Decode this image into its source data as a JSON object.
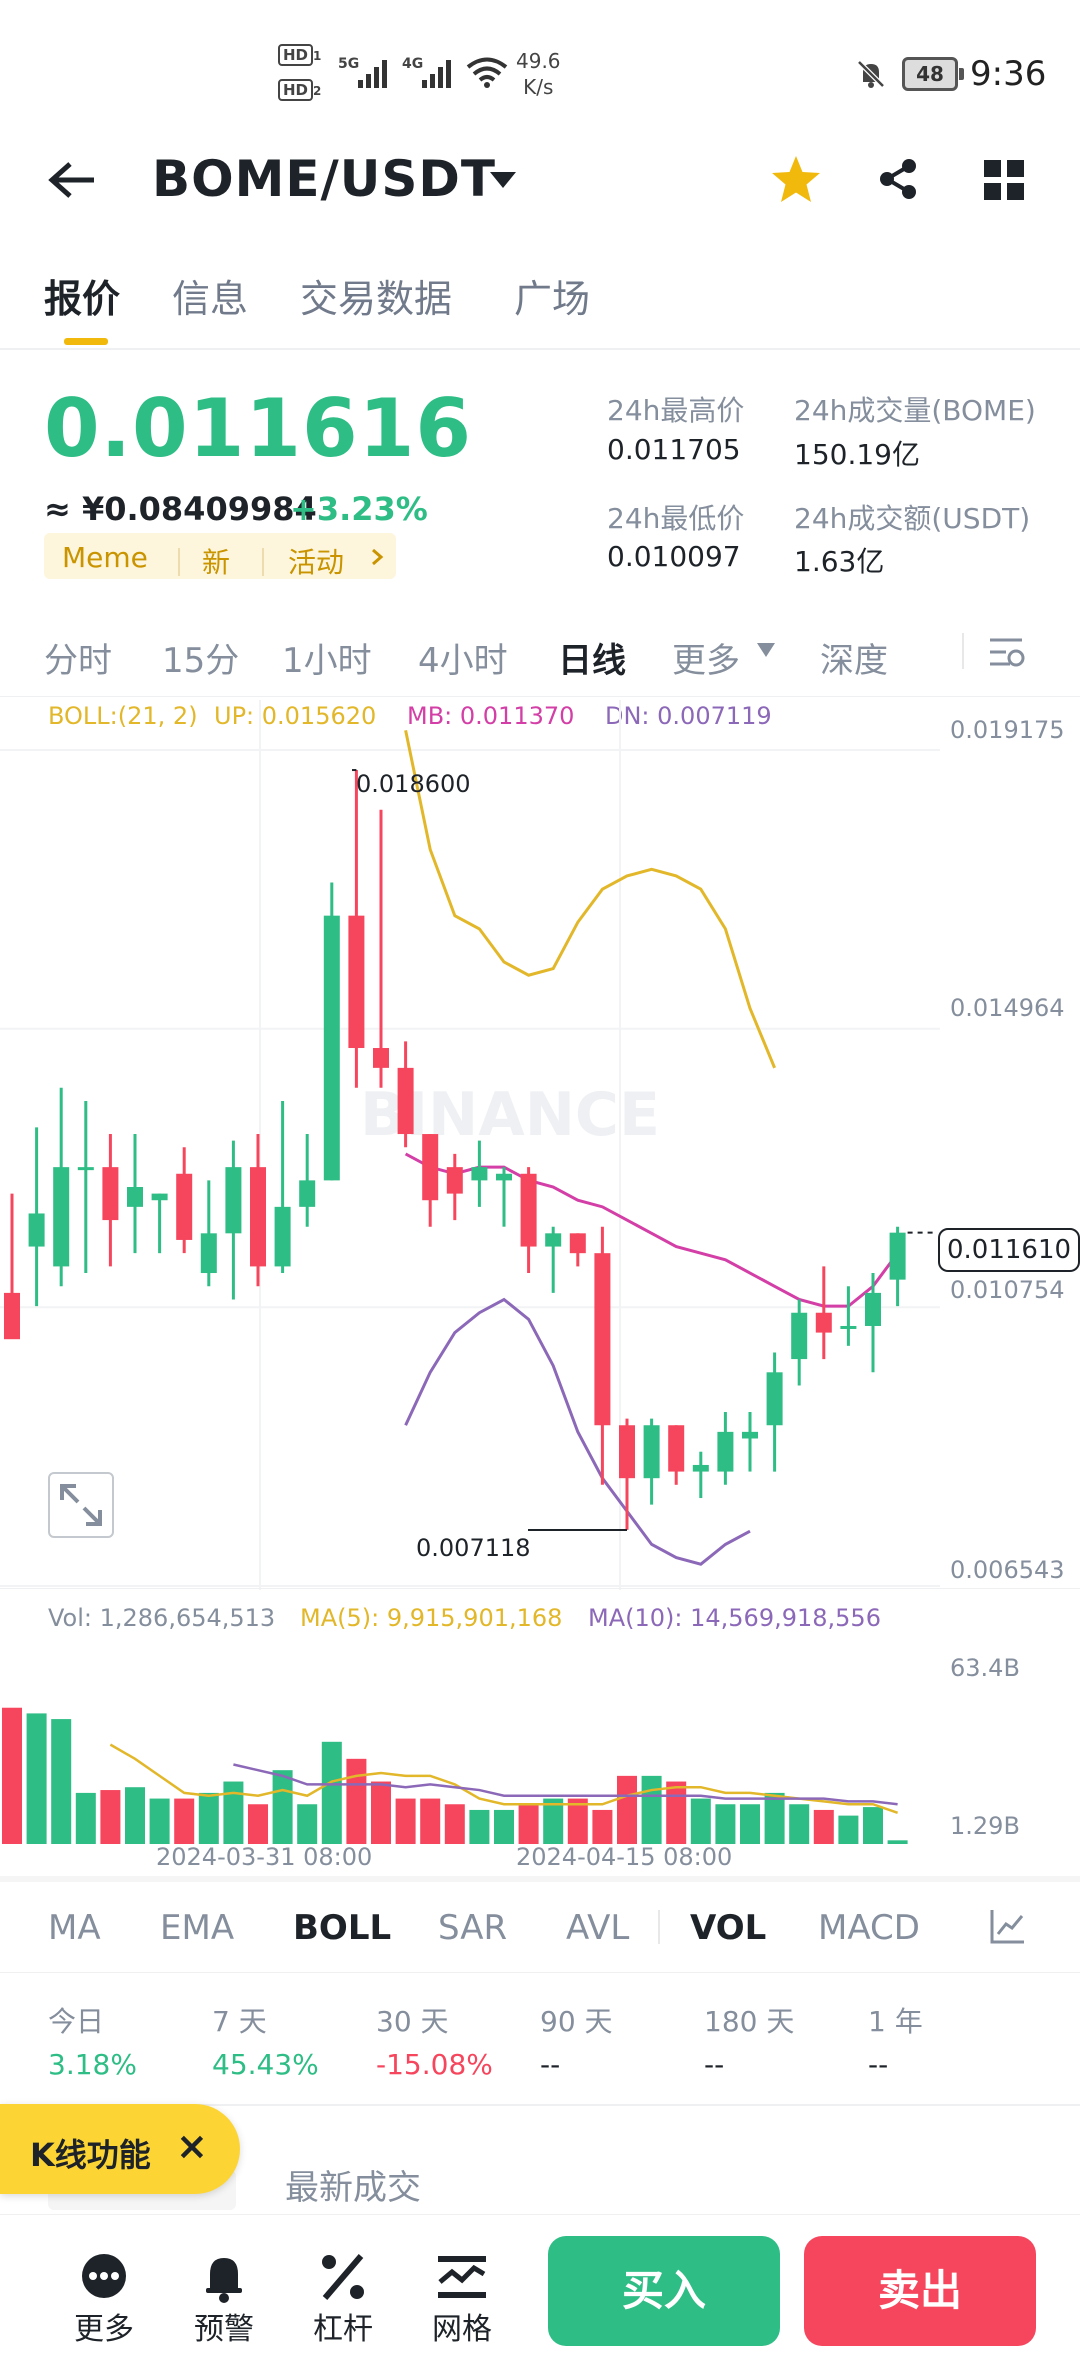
{
  "status_bar": {
    "hd1": "HD",
    "hd1_n": "1",
    "hd2": "HD",
    "hd2_n": "2",
    "sig1": "5G",
    "sig2": "4G",
    "net_speed": "49.6",
    "net_unit": "K/s",
    "battery": "48",
    "time": "9:36"
  },
  "header": {
    "pair": "BOME/USDT",
    "icons": [
      "back-arrow-icon",
      "dropdown-caret-icon",
      "star-icon",
      "share-icon",
      "grid-menu-icon"
    ],
    "star_color": "#f0b90b"
  },
  "tabs": [
    {
      "label": "报价",
      "active": true
    },
    {
      "label": "信息",
      "active": false
    },
    {
      "label": "交易数据",
      "active": false
    },
    {
      "label": "广场",
      "active": false
    }
  ],
  "price": {
    "last": "0.011616",
    "cny": "≈ ¥0.08409984",
    "change": "+3.23%",
    "tags": [
      "Meme",
      "新",
      "活动"
    ],
    "stats": [
      {
        "label": "24h最高价",
        "value": "0.011705"
      },
      {
        "label": "24h成交量(BOME)",
        "value": "150.19亿"
      },
      {
        "label": "24h最低价",
        "value": "0.010097"
      },
      {
        "label": "24h成交额(USDT)",
        "value": "1.63亿"
      }
    ]
  },
  "intervals": [
    {
      "label": "分时",
      "active": false
    },
    {
      "label": "15分",
      "active": false
    },
    {
      "label": "1小时",
      "active": false
    },
    {
      "label": "4小时",
      "active": false
    },
    {
      "label": "日线",
      "active": true
    },
    {
      "label": "更多",
      "active": false
    },
    {
      "label": "深度",
      "active": false
    }
  ],
  "chart_data": {
    "type": "candlestick",
    "indicator": {
      "boll": "BOLL:(21, 2)",
      "up": "UP: 0.015620",
      "mb": "MB: 0.011370",
      "dn": "DN: 0.007119"
    },
    "price_axis": [
      "0.019175",
      "0.014964",
      "0.010754",
      "0.006543"
    ],
    "current_price": "0.011610",
    "high_marker": "0.018600",
    "low_marker": "0.007118",
    "watermark": "BINANCE",
    "colors": {
      "up": "#2ebd85",
      "down": "#f6465d",
      "boll_up": "#e2b72a",
      "boll_mb": "#d33fa6",
      "boll_dn": "#8c68b8"
    },
    "candles": [
      {
        "o": 0.0107,
        "h": 0.0122,
        "l": 0.0102,
        "c": 0.01
      },
      {
        "o": 0.0114,
        "h": 0.0132,
        "l": 0.0105,
        "c": 0.0119
      },
      {
        "o": 0.0111,
        "h": 0.0138,
        "l": 0.0108,
        "c": 0.0126
      },
      {
        "o": 0.0126,
        "h": 0.0136,
        "l": 0.011,
        "c": 0.0126
      },
      {
        "o": 0.0126,
        "h": 0.0131,
        "l": 0.0111,
        "c": 0.0118
      },
      {
        "o": 0.012,
        "h": 0.0131,
        "l": 0.0113,
        "c": 0.0123
      },
      {
        "o": 0.0121,
        "h": 0.0122,
        "l": 0.0113,
        "c": 0.0122
      },
      {
        "o": 0.0125,
        "h": 0.0129,
        "l": 0.0113,
        "c": 0.0115
      },
      {
        "o": 0.011,
        "h": 0.0124,
        "l": 0.0108,
        "c": 0.0116
      },
      {
        "o": 0.0116,
        "h": 0.013,
        "l": 0.0106,
        "c": 0.0126
      },
      {
        "o": 0.0126,
        "h": 0.0131,
        "l": 0.0108,
        "c": 0.0111
      },
      {
        "o": 0.0111,
        "h": 0.0136,
        "l": 0.011,
        "c": 0.012
      },
      {
        "o": 0.012,
        "h": 0.0131,
        "l": 0.0117,
        "c": 0.0124
      },
      {
        "o": 0.0124,
        "h": 0.0169,
        "l": 0.0124,
        "c": 0.0164
      },
      {
        "o": 0.0164,
        "h": 0.0186,
        "l": 0.0138,
        "c": 0.0144
      },
      {
        "o": 0.0144,
        "h": 0.018,
        "l": 0.0138,
        "c": 0.0141
      },
      {
        "o": 0.0141,
        "h": 0.0145,
        "l": 0.0129,
        "c": 0.0131
      },
      {
        "o": 0.0131,
        "h": 0.0131,
        "l": 0.0117,
        "c": 0.0121
      },
      {
        "o": 0.0126,
        "h": 0.0128,
        "l": 0.0118,
        "c": 0.0122
      },
      {
        "o": 0.0124,
        "h": 0.013,
        "l": 0.012,
        "c": 0.0126
      },
      {
        "o": 0.0124,
        "h": 0.0126,
        "l": 0.0117,
        "c": 0.0125
      },
      {
        "o": 0.0125,
        "h": 0.0126,
        "l": 0.011,
        "c": 0.0114
      },
      {
        "o": 0.0114,
        "h": 0.0117,
        "l": 0.0107,
        "c": 0.0116
      },
      {
        "o": 0.0116,
        "h": 0.0116,
        "l": 0.0111,
        "c": 0.0113
      },
      {
        "o": 0.0113,
        "h": 0.0117,
        "l": 0.0078,
        "c": 0.0087
      },
      {
        "o": 0.0087,
        "h": 0.0088,
        "l": 0.00712,
        "c": 0.0079
      },
      {
        "o": 0.0079,
        "h": 0.0088,
        "l": 0.0075,
        "c": 0.0087
      },
      {
        "o": 0.0087,
        "h": 0.0087,
        "l": 0.0078,
        "c": 0.008
      },
      {
        "o": 0.008,
        "h": 0.0083,
        "l": 0.0076,
        "c": 0.0081
      },
      {
        "o": 0.008,
        "h": 0.0089,
        "l": 0.0078,
        "c": 0.0086
      },
      {
        "o": 0.0085,
        "h": 0.0089,
        "l": 0.008,
        "c": 0.0086
      },
      {
        "o": 0.0087,
        "h": 0.0098,
        "l": 0.008,
        "c": 0.0095
      },
      {
        "o": 0.0097,
        "h": 0.0106,
        "l": 0.0093,
        "c": 0.0104
      },
      {
        "o": 0.0104,
        "h": 0.0111,
        "l": 0.0097,
        "c": 0.0101
      },
      {
        "o": 0.0102,
        "h": 0.0108,
        "l": 0.0099,
        "c": 0.0102
      },
      {
        "o": 0.0102,
        "h": 0.011,
        "l": 0.0095,
        "c": 0.0107
      },
      {
        "o": 0.0109,
        "h": 0.0117,
        "l": 0.0105,
        "c": 0.01161
      }
    ],
    "boll_up": [
      null,
      null,
      null,
      null,
      null,
      null,
      null,
      null,
      null,
      null,
      null,
      null,
      null,
      null,
      null,
      null,
      0.0192,
      0.0174,
      0.0164,
      0.0162,
      0.0157,
      0.0155,
      0.0156,
      0.0163,
      0.0168,
      0.017,
      0.0171,
      0.017,
      0.0168,
      0.0162,
      0.015,
      0.0141
    ],
    "boll_mb": [
      null,
      null,
      null,
      null,
      null,
      null,
      null,
      null,
      null,
      null,
      null,
      null,
      null,
      null,
      null,
      null,
      0.0128,
      0.0126,
      0.0125,
      0.0126,
      0.0126,
      0.0124,
      0.0123,
      0.0121,
      0.012,
      0.0118,
      0.0116,
      0.0114,
      0.0113,
      0.0112,
      0.011,
      0.0108,
      0.0106,
      0.0105,
      0.0105,
      0.0108,
      0.0113
    ],
    "boll_dn": [
      null,
      null,
      null,
      null,
      null,
      null,
      null,
      null,
      null,
      null,
      null,
      null,
      null,
      null,
      null,
      null,
      0.0087,
      0.0095,
      0.0101,
      0.0104,
      0.0106,
      0.0103,
      0.0096,
      0.0086,
      0.0079,
      0.0074,
      0.0069,
      0.0067,
      0.0066,
      0.0069,
      0.0071
    ],
    "volume": {
      "label_vol": "Vol: 1,286,654,513",
      "label_ma5": "MA(5): 9,915,901,168",
      "label_ma10": "MA(10): 14,569,918,556",
      "axis": [
        "63.4B",
        "1.29B"
      ],
      "dates": [
        "2024-03-31 08:00",
        "2024-04-15 08:00"
      ],
      "bars": [
        48,
        46,
        44,
        18,
        19,
        20,
        16,
        16,
        18,
        22,
        14,
        26,
        14,
        36,
        30,
        22,
        16,
        16,
        14,
        12,
        12,
        14,
        16,
        16,
        12,
        24,
        24,
        22,
        16,
        14,
        14,
        18,
        14,
        12,
        10,
        13,
        1.3
      ],
      "ma5": [
        null,
        null,
        null,
        null,
        35,
        30,
        24,
        18,
        17,
        18,
        17,
        19,
        17,
        22,
        24,
        25,
        24,
        24,
        21,
        16,
        14,
        14,
        14,
        14,
        14,
        17,
        19,
        20,
        20,
        18,
        18,
        17,
        16,
        15,
        14,
        14,
        11
      ],
      "ma10": [
        null,
        null,
        null,
        null,
        null,
        null,
        null,
        null,
        null,
        28,
        26,
        24,
        21,
        21,
        21,
        21,
        20,
        21,
        20,
        19,
        17,
        17,
        17,
        17,
        17,
        17,
        17,
        17,
        17,
        16,
        16,
        16,
        16,
        16,
        15,
        15,
        14
      ]
    }
  },
  "indicators": [
    {
      "label": "MA",
      "active": false
    },
    {
      "label": "EMA",
      "active": false
    },
    {
      "label": "BOLL",
      "active": true
    },
    {
      "label": "SAR",
      "active": false
    },
    {
      "label": "AVL",
      "active": false
    },
    {
      "label": "VOL",
      "active": true
    },
    {
      "label": "MACD",
      "active": false
    }
  ],
  "performance": [
    {
      "label": "今日",
      "value": "3.18%",
      "color": "#2ebd85"
    },
    {
      "label": "7 天",
      "value": "45.43%",
      "color": "#2ebd85"
    },
    {
      "label": "30 天",
      "value": "-15.08%",
      "color": "#f6465d"
    },
    {
      "label": "90 天",
      "value": "--",
      "color": "#1e2329"
    },
    {
      "label": "180 天",
      "value": "--",
      "color": "#1e2329"
    },
    {
      "label": "1 年",
      "value": "--",
      "color": "#1e2329"
    }
  ],
  "bottom": {
    "kline_features": "K线功能",
    "close": "×",
    "latest_trades": "最新成交",
    "nav": [
      "更多",
      "预警",
      "杠杆",
      "网格"
    ],
    "buy": "买入",
    "sell": "卖出"
  }
}
